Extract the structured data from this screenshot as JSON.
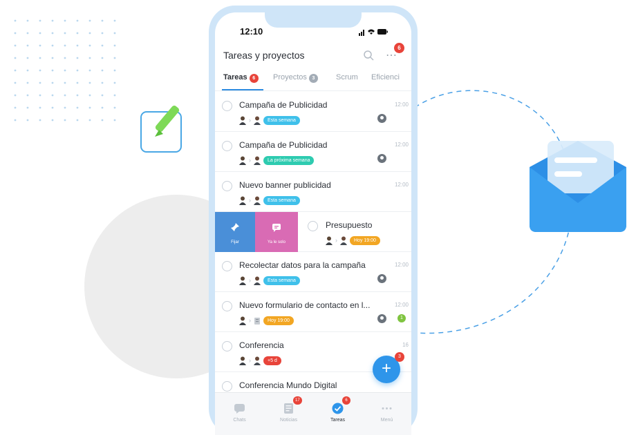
{
  "status_bar": {
    "time": "12:10"
  },
  "header": {
    "title": "Tareas y proyectos",
    "notification_count": "6"
  },
  "tabs": [
    {
      "label": "Tareas",
      "badge": "6",
      "active": true
    },
    {
      "label": "Proyectos",
      "badge": "3"
    },
    {
      "label": "Scrum"
    },
    {
      "label": "Eficienci"
    }
  ],
  "tasks": [
    {
      "title": "Campaña de Publicidad",
      "time": "12:00",
      "tag": "Esta semana",
      "tag_color": "#3fc0ea"
    },
    {
      "title": "Campaña de Publicidad",
      "time": "12:00",
      "tag": "La próxima semana",
      "tag_color": "#2ecbb0"
    },
    {
      "title": "Nuevo banner publicidad",
      "time": "12:00",
      "tag": "Esta semana",
      "tag_color": "#3fc0ea"
    },
    {
      "title": "Presupuesto",
      "time": "",
      "tag": "Hoy 19:00",
      "tag_color": "#f2a623"
    },
    {
      "title": "Recolectar datos para la campaña",
      "time": "12:00",
      "tag": "Esta semana",
      "tag_color": "#3fc0ea"
    },
    {
      "title": "Nuevo formulario de contacto en l...",
      "time": "12:00",
      "tag": "Hoy 19:00",
      "tag_color": "#f2a623",
      "count": "1"
    },
    {
      "title": "Conferencia",
      "time": "16",
      "tag": "+5 d",
      "tag_color": "#e8443a"
    },
    {
      "title": "Conferencia Mundo Digital",
      "time": "",
      "tag": "",
      "tag_color": "#2ecbb0"
    }
  ],
  "swipe_actions": {
    "pin_label": "Fijar",
    "forward_label": "Ya le solo"
  },
  "fab": {
    "label": "+",
    "badge": "3"
  },
  "bottom_nav": [
    {
      "label": "Chats",
      "icon": "chat-icon"
    },
    {
      "label": "Noticias",
      "icon": "news-icon",
      "badge": "17"
    },
    {
      "label": "Tareas",
      "icon": "tasks-check-icon",
      "badge": "6",
      "active": true
    },
    {
      "label": "Menú",
      "icon": "menu-dots-icon"
    }
  ],
  "colors": {
    "accent": "#2e95ea",
    "badge": "#e8443a",
    "phone_frame": "#cfe5f8",
    "pin": "#4a8fd8",
    "forward": "#d96bb4"
  }
}
